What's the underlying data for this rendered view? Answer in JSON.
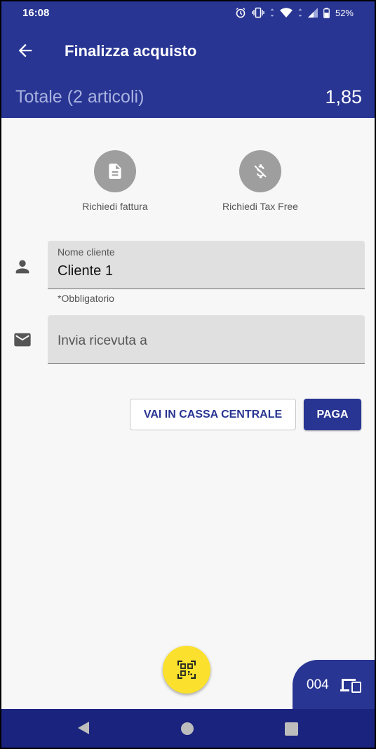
{
  "status_bar": {
    "time": "16:08",
    "battery": "52%",
    "icons": [
      "alarm-icon",
      "vibrate-icon",
      "wifi-icon",
      "signal-icon",
      "battery-icon"
    ]
  },
  "app_bar": {
    "title": "Finalizza acquisto",
    "total_label": "Totale (2 articoli)",
    "total_amount": "1,85"
  },
  "actions": {
    "invoice_label": "Richiedi fattura",
    "tax_free_label": "Richiedi Tax Free"
  },
  "form": {
    "customer_name_label": "Nome cliente",
    "customer_name_value": "Cliente 1",
    "customer_name_helper": "*Obbligatorio",
    "receipt_placeholder": "Invia ricevuta a"
  },
  "buttons": {
    "central_cash_label": "VAI IN CASSA CENTRALE",
    "pay_label": "PAGA"
  },
  "device_tab": {
    "number": "004"
  },
  "colors": {
    "primary": "#283593",
    "navbar": "#1a237e",
    "fab": "#fbe12d",
    "background": "#f7f7f7"
  }
}
